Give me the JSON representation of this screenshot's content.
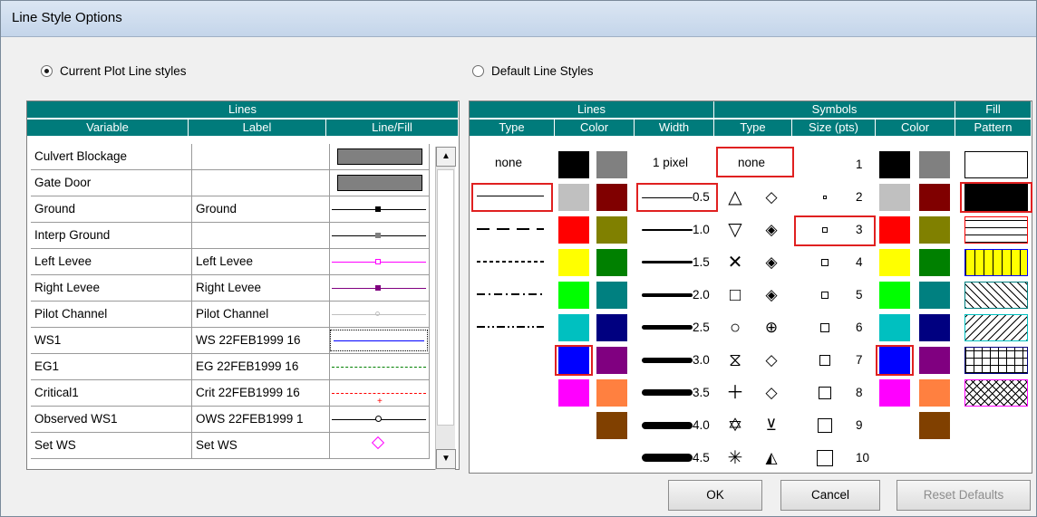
{
  "window": {
    "title": "Line Style Options"
  },
  "options": {
    "current": "Current Plot Line styles",
    "default": "Default Line Styles"
  },
  "left_table": {
    "group_header": "Lines",
    "columns": [
      "Variable",
      "Label",
      "Line/Fill"
    ],
    "rows": [
      {
        "variable": "Culvert Blockage",
        "label": ""
      },
      {
        "variable": "Gate Door",
        "label": ""
      },
      {
        "variable": "Ground",
        "label": "Ground"
      },
      {
        "variable": "Interp Ground",
        "label": ""
      },
      {
        "variable": "Left Levee",
        "label": "Left Levee"
      },
      {
        "variable": "Right Levee",
        "label": "Right Levee"
      },
      {
        "variable": "Pilot Channel",
        "label": "Pilot Channel"
      },
      {
        "variable": "WS1",
        "label": "WS  22FEB1999 16"
      },
      {
        "variable": "EG1",
        "label": "EG  22FEB1999 16"
      },
      {
        "variable": "Critical1",
        "label": "Crit  22FEB1999 16"
      },
      {
        "variable": "Observed WS1",
        "label": "OWS  22FEB1999 1"
      },
      {
        "variable": "Set WS",
        "label": "Set WS"
      }
    ]
  },
  "right_table": {
    "groups": {
      "lines": "Lines",
      "symbols": "Symbols",
      "fill": "Fill",
      "fill2": "Pattern"
    },
    "columns": {
      "type": "Type",
      "color": "Color",
      "width": "Width",
      "sym_type": "Type",
      "size": "Size (pts)",
      "sym_color": "Color"
    },
    "none_label": "none",
    "width_first": "1 pixel",
    "widths": [
      "0.5",
      "1.0",
      "1.5",
      "2.0",
      "2.5",
      "3.0",
      "3.5",
      "4.0",
      "4.5"
    ],
    "sym_none": "none",
    "sizes": [
      "1",
      "2",
      "3",
      "4",
      "5",
      "6",
      "7",
      "8",
      "9",
      "10"
    ]
  },
  "colors": {
    "palette_left": [
      "#000000",
      "#c0c0c0",
      "#ff0000",
      "#ffff00",
      "#00ff00",
      "#00c0c0",
      "#0000ff",
      "#ff00ff",
      ""
    ],
    "palette_right": [
      "#808080",
      "#800000",
      "#808000",
      "#008000",
      "#008080",
      "#000080",
      "#800080",
      "#ff8040",
      "#804000"
    ]
  },
  "buttons": {
    "ok": "OK",
    "cancel": "Cancel",
    "reset": "Reset Defaults"
  }
}
